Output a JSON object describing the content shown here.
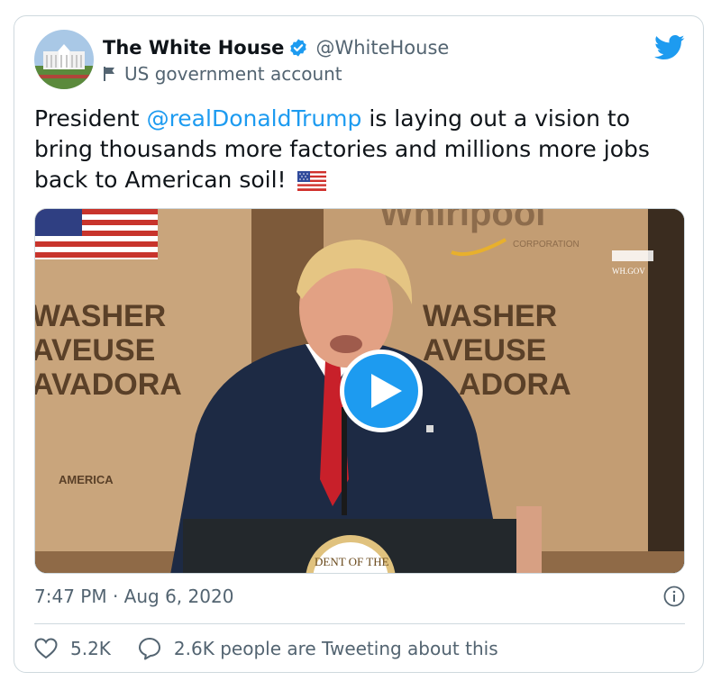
{
  "author": {
    "name": "The White House",
    "handle": "@WhiteHouse",
    "account_label": "US government account"
  },
  "tweet": {
    "text_before": "President ",
    "mention": "@realDonaldTrump",
    "text_after": " is laying out a vision to bring thousands more factories and millions more jobs back to American soil!",
    "emoji": "us-flag"
  },
  "media": {
    "box_text_left": [
      "WASHER",
      "AVEUSE",
      "AVADORA"
    ],
    "box_text_right": [
      "WASHER",
      "AVEUSE",
      "ADORA"
    ],
    "brand_text": "Whirlpool",
    "brand_sub": "CORPORATION",
    "america_text": "AMERICA",
    "watermark": "WH.GOV",
    "seal_text": "DENT OF THE"
  },
  "meta": {
    "time": "7:47 PM",
    "date": "Aug 6, 2020",
    "separator": "·"
  },
  "actions": {
    "likes": "5.2K",
    "tweeting": "2.6K people are Tweeting about this"
  },
  "colors": {
    "accent": "#1d9bf0",
    "text": "#0f1419",
    "muted": "#536471",
    "border": "#cfd9de"
  }
}
